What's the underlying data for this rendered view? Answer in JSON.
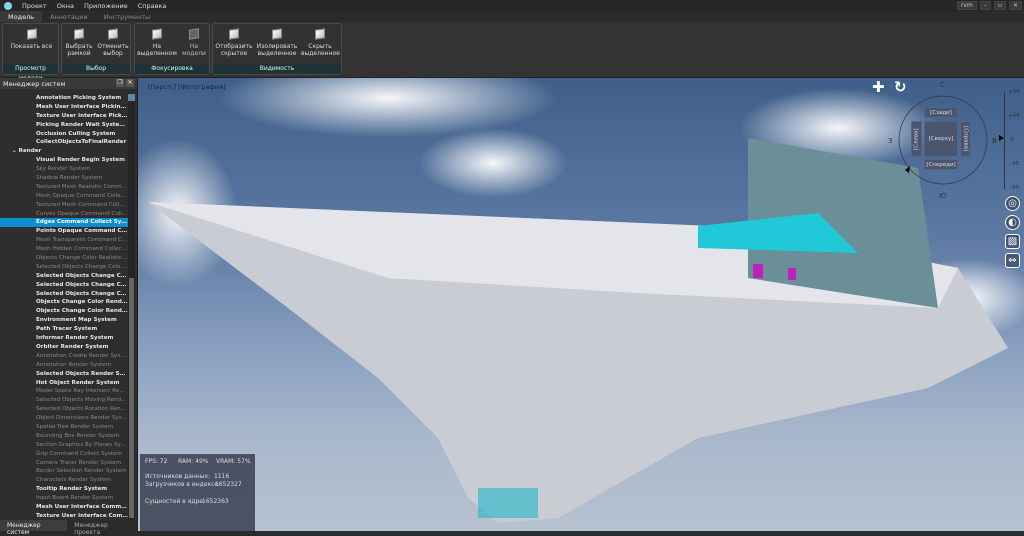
{
  "menu": {
    "items": [
      "Проект",
      "Окна",
      "Приложение",
      "Справка"
    ],
    "user": "rvm",
    "window_buttons": [
      "–",
      "▫",
      "✕"
    ]
  },
  "tabs": [
    {
      "label": "Модель",
      "active": true
    },
    {
      "label": "Аннотации",
      "active": false
    },
    {
      "label": "Инструменты",
      "active": false
    }
  ],
  "ribbon": {
    "groups": [
      {
        "label": "Просмотр модели",
        "buttons": [
          {
            "label1": "Показать все",
            "label2": ""
          }
        ]
      },
      {
        "label": "Выбор",
        "buttons": [
          {
            "label1": "Выбрать",
            "label2": "рамкой"
          },
          {
            "label1": "Отменить",
            "label2": "выбор"
          }
        ]
      },
      {
        "label": "Фокусировка",
        "buttons": [
          {
            "label1": "На",
            "label2": "выделенном"
          },
          {
            "label1": "На",
            "label2": "модели"
          }
        ]
      },
      {
        "label": "Видимость",
        "buttons": [
          {
            "label1": "Отобразить",
            "label2": "скрытое"
          },
          {
            "label1": "Изолировать",
            "label2": "выделенное"
          },
          {
            "label1": "Скрыть",
            "label2": "выделенное"
          }
        ]
      }
    ]
  },
  "panel": {
    "title": "Менеджер систем",
    "items": [
      {
        "t": "Annotation Picking System",
        "s": "on"
      },
      {
        "t": "Mesh User Interface Picking Co...",
        "s": "on"
      },
      {
        "t": "Texture User Interface Picking C...",
        "s": "on"
      },
      {
        "t": "Picking Render Wait Systems",
        "s": "on"
      },
      {
        "t": "Occlusion Culling System",
        "s": "on"
      },
      {
        "t": "CollectObjectsToFinalRender",
        "s": "on"
      },
      {
        "t": "Render",
        "s": "grp"
      },
      {
        "t": "Visual Render Begin System",
        "s": "on"
      },
      {
        "t": "Sky Render System",
        "s": "off"
      },
      {
        "t": "Shadow Render System",
        "s": "off"
      },
      {
        "t": "Textured Mesh Realistic Comma...",
        "s": "off"
      },
      {
        "t": "Mesh Opaque Command Collec...",
        "s": "off"
      },
      {
        "t": "Textured Mesh Command Colle...",
        "s": "off"
      },
      {
        "t": "Curves Opaque Command Colle...",
        "s": "off"
      },
      {
        "t": "Edges Command Collect System",
        "s": "sel"
      },
      {
        "t": "Points Opaque Command Colle...",
        "s": "on"
      },
      {
        "t": "Mesh Transparent Command C...",
        "s": "off"
      },
      {
        "t": "Mesh Hidden Command Collect...",
        "s": "off"
      },
      {
        "t": "Objects Change Color Realistic ...",
        "s": "off"
      },
      {
        "t": "Selected Objects Change Color ...",
        "s": "off"
      },
      {
        "t": "Selected Objects Change Color ...",
        "s": "on"
      },
      {
        "t": "Selected Objects Change Color ...",
        "s": "on"
      },
      {
        "t": "Selected Objects Change Color ...",
        "s": "on"
      },
      {
        "t": "Objects Change Color Render P...",
        "s": "on"
      },
      {
        "t": "Objects Change Color Render P...",
        "s": "on"
      },
      {
        "t": "Environment Map System",
        "s": "on"
      },
      {
        "t": "Path Tracer System",
        "s": "on"
      },
      {
        "t": "Informer Render System",
        "s": "on"
      },
      {
        "t": "Orbiter Render System",
        "s": "on"
      },
      {
        "t": "Annotation Create Render System",
        "s": "off"
      },
      {
        "t": "Annotation Render System",
        "s": "off"
      },
      {
        "t": "Selected Objects Render System",
        "s": "on"
      },
      {
        "t": "Hot Object Render System",
        "s": "on"
      },
      {
        "t": "Model Space Ray Intersect Ren...",
        "s": "off"
      },
      {
        "t": "Selected Objects Moving Rende...",
        "s": "off"
      },
      {
        "t": "Selected Objects Rotation Rend...",
        "s": "off"
      },
      {
        "t": "Object Dimensions Render Syst...",
        "s": "off"
      },
      {
        "t": "Spatial Tree Render System",
        "s": "off"
      },
      {
        "t": "Bounding Box Render System",
        "s": "off"
      },
      {
        "t": "Section Graphics By Planes Syst...",
        "s": "off"
      },
      {
        "t": "Grip Command Collect System",
        "s": "off"
      },
      {
        "t": "Camera Tracer Render System",
        "s": "off"
      },
      {
        "t": "Border Selection Render System",
        "s": "off"
      },
      {
        "t": "Characters Render System",
        "s": "off"
      },
      {
        "t": "Tooltip Render System",
        "s": "on"
      },
      {
        "t": "Input Board Render System",
        "s": "off"
      },
      {
        "t": "Mesh User Interface Command ...",
        "s": "on"
      },
      {
        "t": "Texture User Interface Comman...",
        "s": "on"
      },
      {
        "t": "Compass Pointer Render System",
        "s": "on"
      }
    ],
    "bottom_tabs": [
      {
        "label": "Менеджер систем",
        "active": true
      },
      {
        "label": "Менеджер проекта",
        "active": false
      }
    ]
  },
  "viewport": {
    "label": "[Персп.] [Фотография]",
    "stats": {
      "fps": "FPS: 72",
      "ram": "RAM: 49%",
      "vram": "VRAM: 57%",
      "sources_label": "Источников данных:",
      "sources": "1116",
      "loaders_label": "Загрузчиков в индексе:",
      "loaders": "1652327",
      "entities_label": "Сущностей в ядре:",
      "entities": "1652363"
    },
    "compass": {
      "n": "С",
      "s": "Ю",
      "w": "З",
      "e": "В",
      "back": "[Сзади]",
      "top": "[Сверху]",
      "front": "[Спереди]",
      "left": "[Слева]",
      "right": "[Справа]"
    },
    "pitch_scale": [
      "+90",
      "+45",
      "0",
      "-45",
      "-90"
    ],
    "tools": [
      "pin-icon",
      "sphere-icon",
      "section-box-icon",
      "fit-width-icon"
    ]
  },
  "colors": {
    "accent": "#0a8ed0",
    "selection_magenta": "#c020c0",
    "highlight_cyan": "#20c8d8"
  }
}
